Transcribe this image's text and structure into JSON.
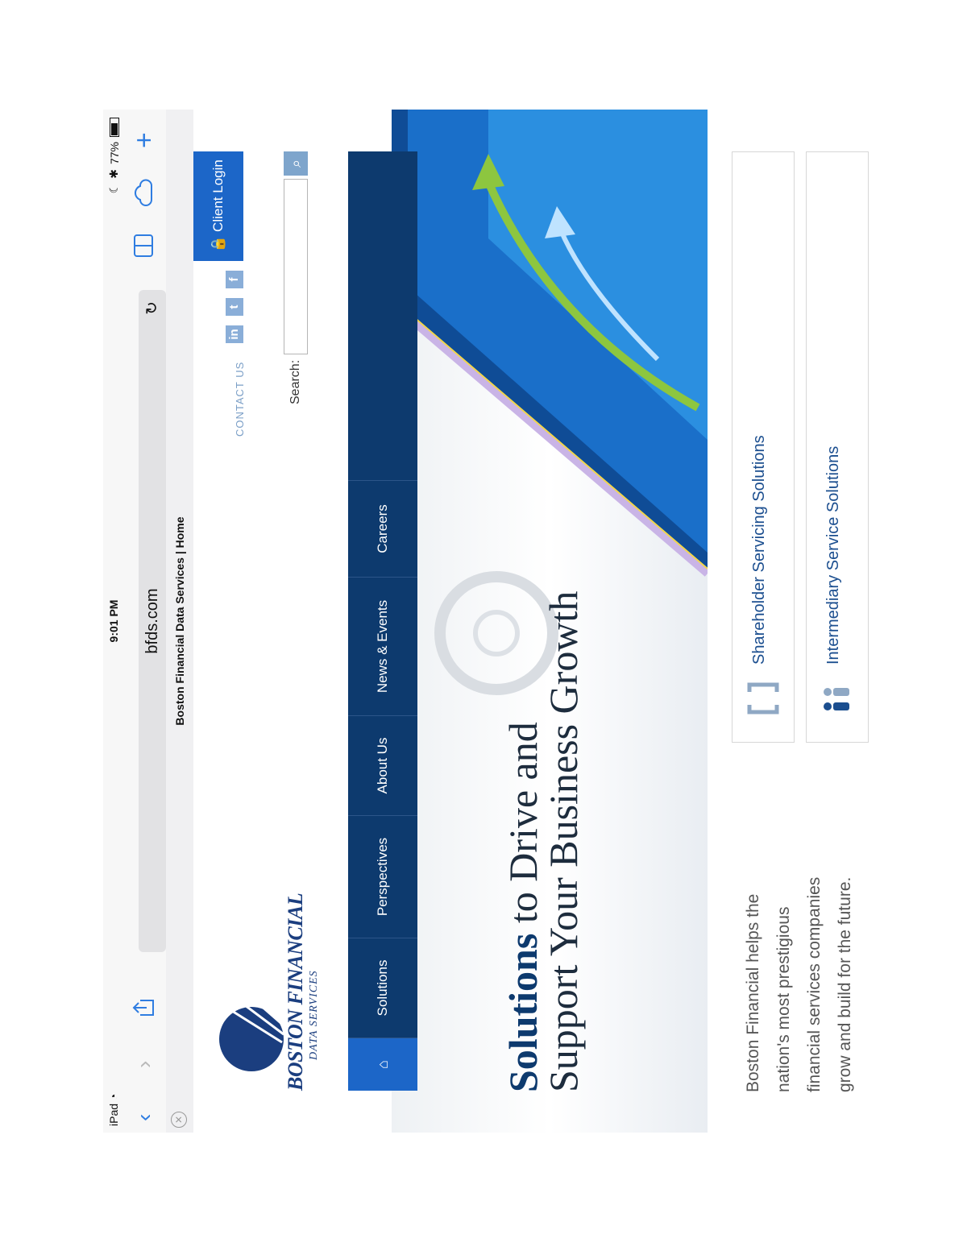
{
  "statusbar": {
    "device": "iPad",
    "time": "9:01 PM",
    "battery": "77%"
  },
  "toolbar": {
    "url": "bfds.com"
  },
  "tab": {
    "title": "Boston Financial Data Services | Home"
  },
  "header": {
    "logo_name": "BOSTON FINANCIAL",
    "logo_sub": "DATA SERVICES",
    "client_login": "Client Login",
    "contact": "CONTACT US",
    "search_label": "Search:"
  },
  "nav": {
    "items": [
      "Solutions",
      "Perspectives",
      "About Us",
      "News & Events",
      "Careers"
    ]
  },
  "hero": {
    "title_strong": "Solutions",
    "title_rest_1": " to Drive and",
    "title_line2": "Support Your Business Growth"
  },
  "intro": "Boston Financial helps the nation's most prestigious financial services companies grow and build for the future.",
  "cards": [
    {
      "label": "Shareholder Servicing Solutions"
    },
    {
      "label": "Intermediary Service Solutions"
    }
  ],
  "colors": {
    "nav_bg": "#0d3a6e",
    "accent_blue": "#1c66c8",
    "brand": "#1b3e7f"
  }
}
